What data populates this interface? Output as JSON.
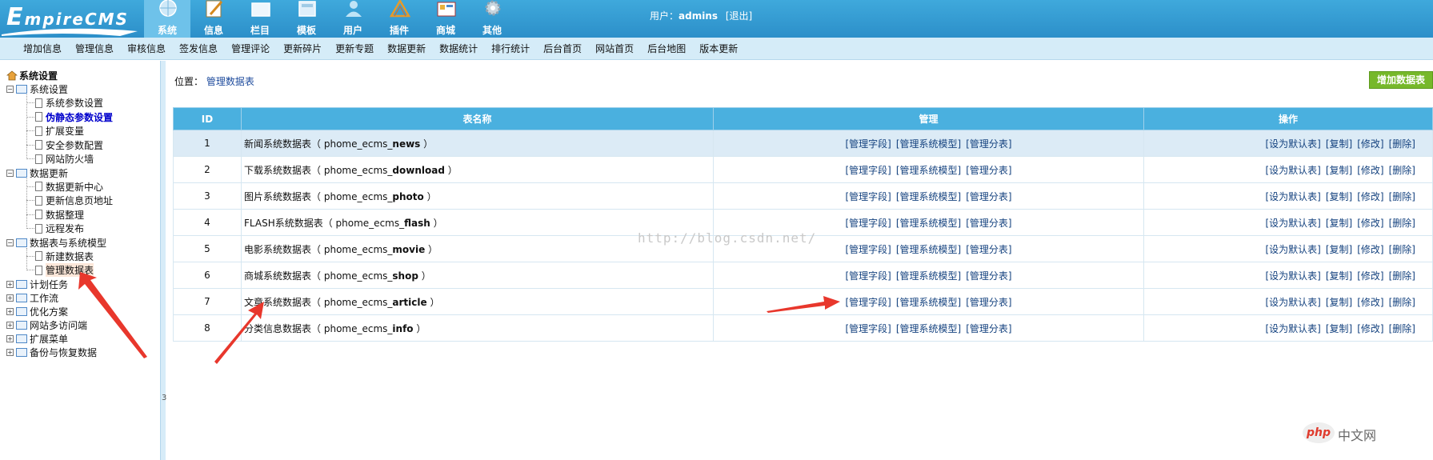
{
  "header": {
    "logo": "EmpireCMS",
    "user_label": "用户：",
    "username": "admins",
    "logout": "[退出]",
    "nav": [
      {
        "label": "系统",
        "icon": "globe-icon",
        "active": true
      },
      {
        "label": "信息",
        "icon": "pencil-paper-icon"
      },
      {
        "label": "栏目",
        "icon": "folder-icon"
      },
      {
        "label": "模板",
        "icon": "template-icon"
      },
      {
        "label": "用户",
        "icon": "user-icon"
      },
      {
        "label": "插件",
        "icon": "plugin-icon"
      },
      {
        "label": "商城",
        "icon": "shop-icon"
      },
      {
        "label": "其他",
        "icon": "gear-icon"
      }
    ]
  },
  "subnav": [
    "增加信息",
    "管理信息",
    "审核信息",
    "签发信息",
    "管理评论",
    "更新碎片",
    "更新专题",
    "数据更新",
    "数据统计",
    "排行统计",
    "后台首页",
    "网站首页",
    "后台地图",
    "版本更新"
  ],
  "sidebar": {
    "root": "系统设置",
    "groups": [
      {
        "label": "系统设置",
        "expanded": true,
        "items": [
          "系统参数设置",
          "伪静态参数设置",
          "扩展变量",
          "安全参数配置",
          "网站防火墙"
        ]
      },
      {
        "label": "数据更新",
        "expanded": true,
        "items": [
          "数据更新中心",
          "更新信息页地址",
          "数据整理",
          "远程发布"
        ]
      },
      {
        "label": "数据表与系统模型",
        "expanded": true,
        "items": [
          "新建数据表",
          "管理数据表"
        ]
      },
      {
        "label": "计划任务",
        "expanded": false
      },
      {
        "label": "工作流",
        "expanded": false
      },
      {
        "label": "优化方案",
        "expanded": false
      },
      {
        "label": "网站多访问端",
        "expanded": false
      },
      {
        "label": "扩展菜单",
        "expanded": false
      },
      {
        "label": "备份与恢复数据",
        "expanded": false
      }
    ],
    "splitter_mark": "3"
  },
  "content": {
    "crumb_label": "位置：",
    "crumb_link": "管理数据表",
    "add_button": "增加数据表",
    "columns": [
      "ID",
      "表名称",
      "管理",
      "操作"
    ],
    "rows": [
      {
        "id": "1",
        "name": "新闻系统数据表",
        "table": "phome_ecms_",
        "suffix": "news"
      },
      {
        "id": "2",
        "name": "下载系统数据表",
        "table": "phome_ecms_",
        "suffix": "download"
      },
      {
        "id": "3",
        "name": "图片系统数据表",
        "table": "phome_ecms_",
        "suffix": "photo"
      },
      {
        "id": "4",
        "name": "FLASH系统数据表",
        "table": "phome_ecms_",
        "suffix": "flash"
      },
      {
        "id": "5",
        "name": "电影系统数据表",
        "table": "phome_ecms_",
        "suffix": "movie"
      },
      {
        "id": "6",
        "name": "商城系统数据表",
        "table": "phome_ecms_",
        "suffix": "shop"
      },
      {
        "id": "7",
        "name": "文章系统数据表",
        "table": "phome_ecms_",
        "suffix": "article"
      },
      {
        "id": "8",
        "name": "分类信息数据表",
        "table": "phome_ecms_",
        "suffix": "info"
      }
    ],
    "mgmt_links": [
      "[管理字段]",
      "[管理系统模型]",
      "[管理分表]"
    ],
    "op_links": [
      "[设为默认表]",
      "[复制]",
      "[修改]",
      "[删除]"
    ]
  },
  "watermark": "http://blog.csdn.net/",
  "corner_logo": {
    "badge": "php",
    "text": "中文网"
  },
  "colors": {
    "header": "#2c8fc9",
    "subnav": "#d5ecf8",
    "table_header": "#4ab0df",
    "add_button": "#76b82a",
    "arrow": "#e8372c"
  }
}
